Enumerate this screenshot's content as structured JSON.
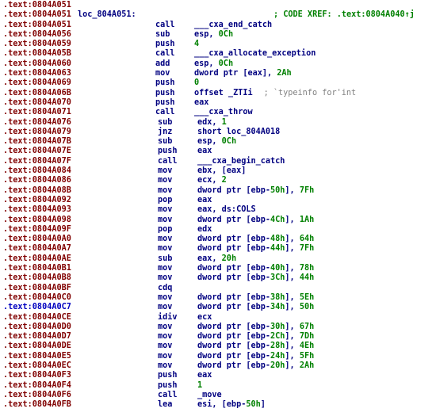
{
  "view": "IDA disassembly listing",
  "colors": {
    "address": "#800000",
    "address_highlight": "#0000c0",
    "instruction": "#000080",
    "number": "#008000",
    "comment": "#808080"
  },
  "rows": [
    {
      "addr": ".text:0804A051"
    },
    {
      "addr": ".text:0804A051",
      "label": "loc_804A051:",
      "xref": "; CODE XREF: .text:0804A040↑j"
    },
    {
      "addr": ".text:0804A051",
      "mn": "call",
      "op": [
        {
          "t": "___cxa_end_catch"
        }
      ]
    },
    {
      "addr": ".text:0804A056",
      "mn": "sub",
      "op": [
        {
          "t": "esp, "
        },
        {
          "t": "0Ch",
          "n": 1
        }
      ]
    },
    {
      "addr": ".text:0804A059",
      "mn": "push",
      "op": [
        {
          "t": "4",
          "n": 1
        }
      ]
    },
    {
      "addr": ".text:0804A05B",
      "mn": "call",
      "op": [
        {
          "t": "___cxa_allocate_exception"
        }
      ]
    },
    {
      "addr": ".text:0804A060",
      "mn": "add",
      "op": [
        {
          "t": "esp, "
        },
        {
          "t": "0Ch",
          "n": 1
        }
      ]
    },
    {
      "addr": ".text:0804A063",
      "mn": "mov",
      "op": [
        {
          "t": "dword ptr [eax], "
        },
        {
          "t": "2Ah",
          "n": 1
        }
      ]
    },
    {
      "addr": ".text:0804A069",
      "mn": "push",
      "op": [
        {
          "t": "0",
          "n": 1
        }
      ]
    },
    {
      "addr": ".text:0804A06B",
      "mn": "push",
      "op": [
        {
          "t": "offset _ZTIi"
        }
      ],
      "cmt": "; `typeinfo for'int"
    },
    {
      "addr": ".text:0804A070",
      "mn": "push",
      "op": [
        {
          "t": "eax"
        }
      ]
    },
    {
      "addr": ".text:0804A071",
      "mn": "call",
      "op": [
        {
          "t": "___cxa_throw"
        }
      ]
    },
    {
      "addr": ".text:0804A076",
      "mn": "sub",
      "op": [
        {
          "t": "edx, "
        },
        {
          "t": "1",
          "n": 1
        }
      ],
      "shift": 1
    },
    {
      "addr": ".text:0804A079",
      "mn": "jnz",
      "op": [
        {
          "t": "short loc_804A018"
        }
      ],
      "shift": 1
    },
    {
      "addr": ".text:0804A07B",
      "mn": "sub",
      "op": [
        {
          "t": "esp, "
        },
        {
          "t": "0Ch",
          "n": 1
        }
      ],
      "shift": 1
    },
    {
      "addr": ".text:0804A07E",
      "mn": "push",
      "op": [
        {
          "t": "eax"
        }
      ],
      "shift": 1
    },
    {
      "addr": ".text:0804A07F",
      "mn": "call",
      "op": [
        {
          "t": "___cxa_begin_catch"
        }
      ],
      "shift": 1
    },
    {
      "addr": ".text:0804A084",
      "mn": "mov",
      "op": [
        {
          "t": "ebx, [eax]"
        }
      ],
      "shift": 1
    },
    {
      "addr": ".text:0804A086",
      "mn": "mov",
      "op": [
        {
          "t": "ecx, "
        },
        {
          "t": "2",
          "n": 1
        }
      ],
      "shift": 1
    },
    {
      "addr": ".text:0804A08B",
      "mn": "mov",
      "op": [
        {
          "t": "dword ptr [ebp-"
        },
        {
          "t": "50h",
          "n": 1
        },
        {
          "t": "], "
        },
        {
          "t": "7Fh",
          "n": 1
        }
      ],
      "shift": 1
    },
    {
      "addr": ".text:0804A092",
      "mn": "pop",
      "op": [
        {
          "t": "eax"
        }
      ],
      "shift": 1
    },
    {
      "addr": ".text:0804A093",
      "mn": "mov",
      "op": [
        {
          "t": "eax, ds:COLS"
        }
      ],
      "shift": 1
    },
    {
      "addr": ".text:0804A098",
      "mn": "mov",
      "op": [
        {
          "t": "dword ptr [ebp-"
        },
        {
          "t": "4Ch",
          "n": 1
        },
        {
          "t": "], "
        },
        {
          "t": "1Ah",
          "n": 1
        }
      ],
      "shift": 1
    },
    {
      "addr": ".text:0804A09F",
      "mn": "pop",
      "op": [
        {
          "t": "edx"
        }
      ],
      "shift": 1
    },
    {
      "addr": ".text:0804A0A0",
      "mn": "mov",
      "op": [
        {
          "t": "dword ptr [ebp-"
        },
        {
          "t": "48h",
          "n": 1
        },
        {
          "t": "], "
        },
        {
          "t": "64h",
          "n": 1
        }
      ],
      "shift": 1
    },
    {
      "addr": ".text:0804A0A7",
      "mn": "mov",
      "op": [
        {
          "t": "dword ptr [ebp-"
        },
        {
          "t": "44h",
          "n": 1
        },
        {
          "t": "], "
        },
        {
          "t": "7Fh",
          "n": 1
        }
      ],
      "shift": 1
    },
    {
      "addr": ".text:0804A0AE",
      "mn": "sub",
      "op": [
        {
          "t": "eax, "
        },
        {
          "t": "20h",
          "n": 1
        }
      ],
      "shift": 1
    },
    {
      "addr": ".text:0804A0B1",
      "mn": "mov",
      "op": [
        {
          "t": "dword ptr [ebp-"
        },
        {
          "t": "40h",
          "n": 1
        },
        {
          "t": "], "
        },
        {
          "t": "78h",
          "n": 1
        }
      ],
      "shift": 1
    },
    {
      "addr": ".text:0804A0B8",
      "mn": "mov",
      "op": [
        {
          "t": "dword ptr [ebp-"
        },
        {
          "t": "3Ch",
          "n": 1
        },
        {
          "t": "], "
        },
        {
          "t": "44h",
          "n": 1
        }
      ],
      "shift": 1
    },
    {
      "addr": ".text:0804A0BF",
      "mn": "cdq",
      "op": [],
      "shift": 1
    },
    {
      "addr": ".text:0804A0C0",
      "mn": "mov",
      "op": [
        {
          "t": "dword ptr [ebp-"
        },
        {
          "t": "38h",
          "n": 1
        },
        {
          "t": "], "
        },
        {
          "t": "5Eh",
          "n": 1
        }
      ],
      "shift": 1
    },
    {
      "addr": ".text:0804A0C7",
      "hl": 1,
      "mn": "mov",
      "op": [
        {
          "t": "dword ptr [ebp-"
        },
        {
          "t": "34h",
          "n": 1
        },
        {
          "t": "], "
        },
        {
          "t": "50h",
          "n": 1
        }
      ],
      "shift": 1
    },
    {
      "addr": ".text:0804A0CE",
      "mn": "idiv",
      "op": [
        {
          "t": "ecx"
        }
      ],
      "shift": 1
    },
    {
      "addr": ".text:0804A0D0",
      "mn": "mov",
      "op": [
        {
          "t": "dword ptr [ebp-"
        },
        {
          "t": "30h",
          "n": 1
        },
        {
          "t": "], "
        },
        {
          "t": "67h",
          "n": 1
        }
      ],
      "shift": 1
    },
    {
      "addr": ".text:0804A0D7",
      "mn": "mov",
      "op": [
        {
          "t": "dword ptr [ebp-"
        },
        {
          "t": "2Ch",
          "n": 1
        },
        {
          "t": "], "
        },
        {
          "t": "7Dh",
          "n": 1
        }
      ],
      "shift": 1
    },
    {
      "addr": ".text:0804A0DE",
      "mn": "mov",
      "op": [
        {
          "t": "dword ptr [ebp-"
        },
        {
          "t": "28h",
          "n": 1
        },
        {
          "t": "], "
        },
        {
          "t": "4Eh",
          "n": 1
        }
      ],
      "shift": 1
    },
    {
      "addr": ".text:0804A0E5",
      "mn": "mov",
      "op": [
        {
          "t": "dword ptr [ebp-"
        },
        {
          "t": "24h",
          "n": 1
        },
        {
          "t": "], "
        },
        {
          "t": "5Fh",
          "n": 1
        }
      ],
      "shift": 1
    },
    {
      "addr": ".text:0804A0EC",
      "mn": "mov",
      "op": [
        {
          "t": "dword ptr [ebp-"
        },
        {
          "t": "20h",
          "n": 1
        },
        {
          "t": "], "
        },
        {
          "t": "2Ah",
          "n": 1
        }
      ],
      "shift": 1
    },
    {
      "addr": ".text:0804A0F3",
      "mn": "push",
      "op": [
        {
          "t": "eax"
        }
      ],
      "shift": 1
    },
    {
      "addr": ".text:0804A0F4",
      "mn": "push",
      "op": [
        {
          "t": "1",
          "n": 1
        }
      ],
      "shift": 1
    },
    {
      "addr": ".text:0804A0F6",
      "mn": "call",
      "op": [
        {
          "t": "_move"
        }
      ],
      "shift": 1
    },
    {
      "addr": ".text:0804A0FB",
      "mn": "lea",
      "op": [
        {
          "t": "esi, [ebp-"
        },
        {
          "t": "50h",
          "n": 1
        },
        {
          "t": "]"
        }
      ],
      "shift": 1
    }
  ]
}
